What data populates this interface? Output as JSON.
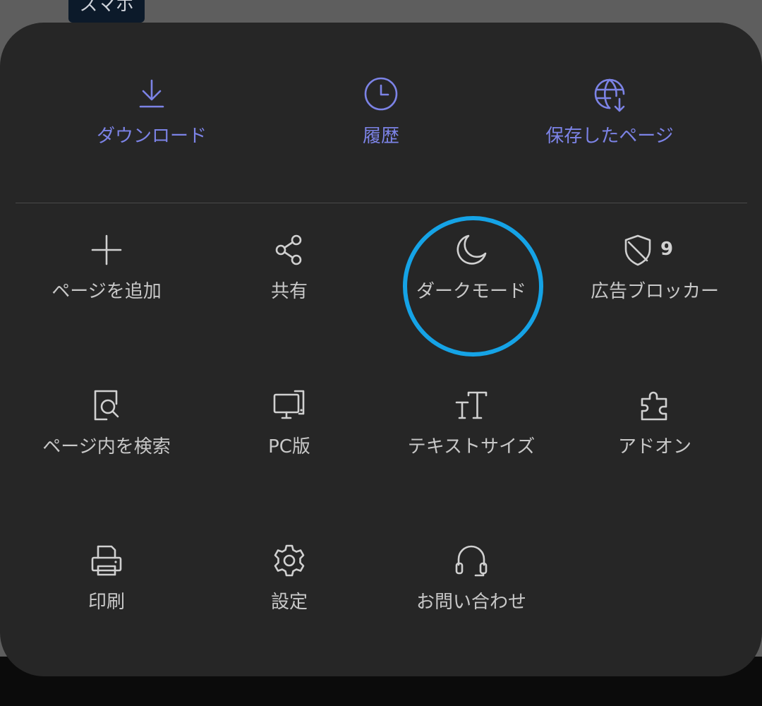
{
  "background_tag": {
    "label": "スマホ"
  },
  "colors": {
    "accent": "#7c83e6",
    "sheet_background": "#262626",
    "icon": "#d0d0d0",
    "highlight_ring": "#15a3e6"
  },
  "quick_actions": {
    "download": {
      "label": "ダウンロード",
      "icon": "download-icon"
    },
    "history": {
      "label": "履歴",
      "icon": "clock-icon"
    },
    "saved_pages": {
      "label": "保存したページ",
      "icon": "globe-download-icon"
    }
  },
  "menu": {
    "add_page": {
      "label": "ページを追加",
      "icon": "plus-icon"
    },
    "share": {
      "label": "共有",
      "icon": "share-icon"
    },
    "dark_mode": {
      "label": "ダークモード",
      "icon": "moon-icon"
    },
    "ad_blocker": {
      "label": "広告ブロッカー",
      "icon": "shield-icon",
      "badge": "9"
    },
    "find_in_page": {
      "label": "ページ内を検索",
      "icon": "find-in-page-icon"
    },
    "desktop_site": {
      "label": "PC版",
      "icon": "desktop-icon"
    },
    "text_size": {
      "label": "テキストサイズ",
      "icon": "text-size-icon"
    },
    "addons": {
      "label": "アドオン",
      "icon": "puzzle-icon"
    },
    "print": {
      "label": "印刷",
      "icon": "printer-icon"
    },
    "settings": {
      "label": "設定",
      "icon": "gear-icon"
    },
    "contact": {
      "label": "お問い合わせ",
      "icon": "headset-icon"
    }
  }
}
